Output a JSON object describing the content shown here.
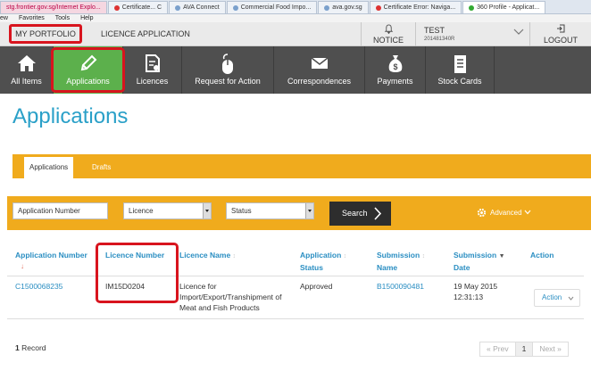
{
  "browser": {
    "tabs": [
      {
        "label": "stg.frontier.gov.sg/Internet Explo..."
      },
      {
        "label": "Certificate... C"
      },
      {
        "label": "AVA Connect"
      },
      {
        "label": "Commercial Food Impo..."
      },
      {
        "label": "ava.gov.sg"
      },
      {
        "label": "Certificate Error: Naviga..."
      },
      {
        "label": "360 Profile - Applicat..."
      }
    ],
    "menu": [
      "ew",
      "Favorites",
      "Tools",
      "Help"
    ]
  },
  "topbar": {
    "portfolio": "MY PORTFOLIO",
    "licence_application": "LICENCE APPLICATION",
    "notice": "NOTICE",
    "user_name": "TEST",
    "user_id": "201481340R",
    "logout": "LOGOUT"
  },
  "nav": {
    "items": [
      {
        "label": "All Items",
        "icon": "home-icon"
      },
      {
        "label": "Applications",
        "icon": "pencil-icon"
      },
      {
        "label": "Licences",
        "icon": "licence-doc-icon"
      },
      {
        "label": "Request for Action",
        "icon": "mouse-icon"
      },
      {
        "label": "Correspondences",
        "icon": "envelope-icon"
      },
      {
        "label": "Payments",
        "icon": "money-bag-icon"
      },
      {
        "label": "Stock Cards",
        "icon": "document-icon"
      }
    ]
  },
  "page": {
    "title": "Applications"
  },
  "tabs": {
    "applications": "Applications",
    "drafts": "Drafts"
  },
  "filters": {
    "application_number": "Application Number",
    "licence": "Licence",
    "status": "Status",
    "search": "Search",
    "advanced": "Advanced"
  },
  "table": {
    "headers": {
      "application_number": "Application Number",
      "licence_number": "Licence Number",
      "licence_name": "Licence Name",
      "application_status_1": "Application",
      "application_status_2": "Status",
      "submission_name_1": "Submission",
      "submission_name_2": "Name",
      "submission_date_1": "Submission",
      "submission_date_2": "Date",
      "action": "Action"
    },
    "rows": [
      {
        "application_number": "C1500068235",
        "licence_number": "IM15D0204",
        "licence_name_1": "Licence for",
        "licence_name_2": "Import/Export/Transhipment of",
        "licence_name_3": "Meat and Fish Products",
        "status": "Approved",
        "submission_name": "B1500090481",
        "submission_date_1": "19 May 2015",
        "submission_date_2": "12:31:13",
        "action": "Action"
      }
    ]
  },
  "footer": {
    "record_count": "1",
    "record_label": "Record",
    "prev": "« Prev",
    "page": "1",
    "next": "Next »"
  }
}
